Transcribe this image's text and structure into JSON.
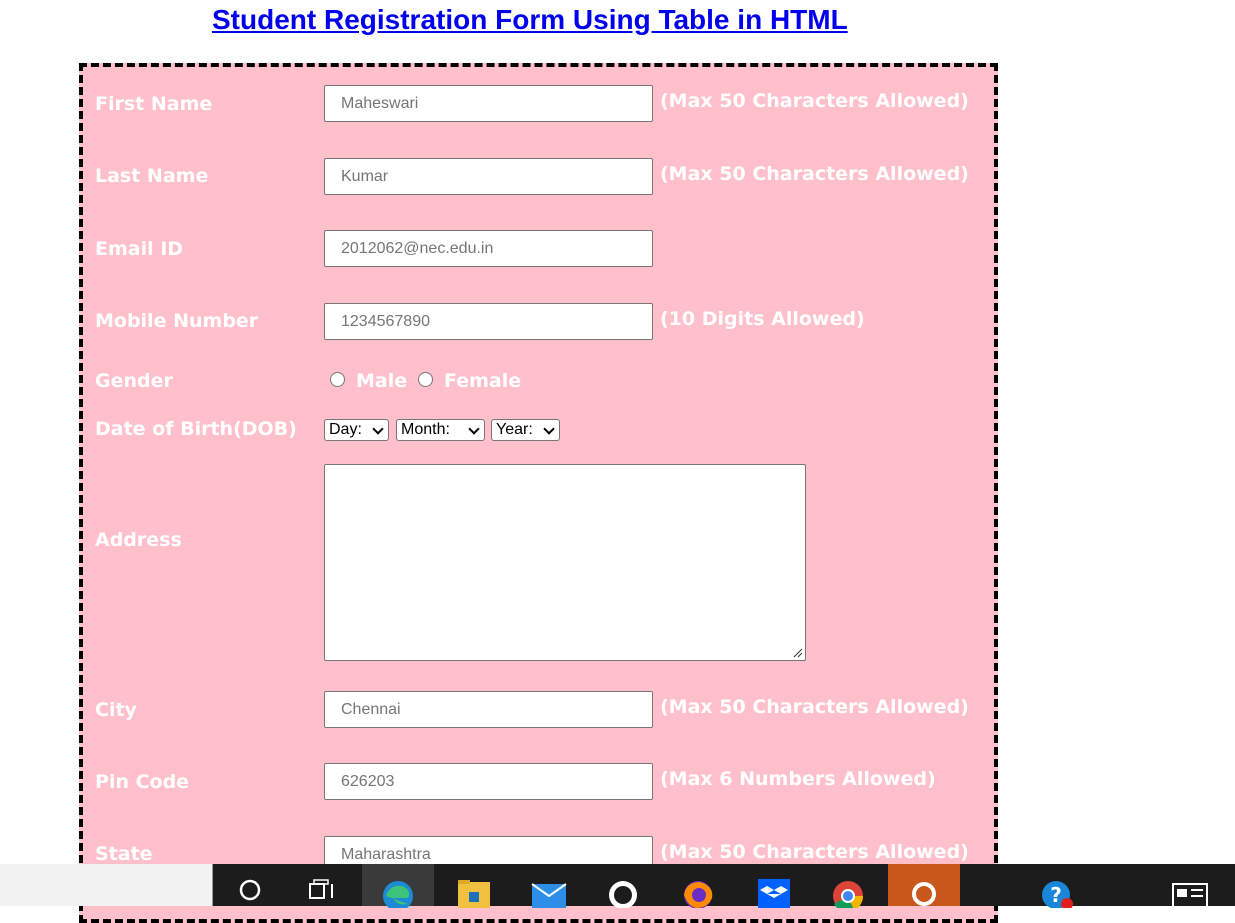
{
  "page": {
    "title": "Student Registration Form Using Table in HTML"
  },
  "form": {
    "first_name": {
      "label": "First Name",
      "value": "Maheswari",
      "hint": "(Max 50 Characters Allowed)"
    },
    "last_name": {
      "label": "Last Name",
      "value": "Kumar",
      "hint": "(Max 50 Characters Allowed)"
    },
    "email": {
      "label": "Email ID",
      "value": "2012062@nec.edu.in"
    },
    "mobile": {
      "label": "Mobile Number",
      "value": "1234567890",
      "hint": "(10 Digits Allowed)"
    },
    "gender": {
      "label": "Gender",
      "options": [
        "Male",
        "Female"
      ]
    },
    "dob": {
      "label": "Date of Birth(DOB)",
      "day": "Day:",
      "month": "Month:",
      "year": "Year:"
    },
    "address": {
      "label": "Address",
      "value": ""
    },
    "city": {
      "label": "City",
      "value": "Chennai",
      "hint": "(Max 50 Characters Allowed)"
    },
    "pin": {
      "label": "Pin Code",
      "value": "626203",
      "hint": "(Max 6 Numbers Allowed)"
    },
    "state": {
      "label": "State",
      "value": "Maharashtra",
      "hint": "(Max 50 Characters Allowed)"
    }
  },
  "colors": {
    "form_background": "#ffc0cb",
    "label_text": "#ffffff",
    "title_link": "#0000ee",
    "taskbar": "#1c1c1c"
  },
  "taskbar": {
    "icons": [
      "cortana-icon",
      "task-view-icon",
      "edge-icon",
      "file-explorer-icon",
      "mail-icon",
      "github-icon",
      "firefox-icon",
      "dropbox-icon",
      "chrome-icon",
      "orange-app-icon",
      "help-icon",
      "news-icon"
    ]
  }
}
